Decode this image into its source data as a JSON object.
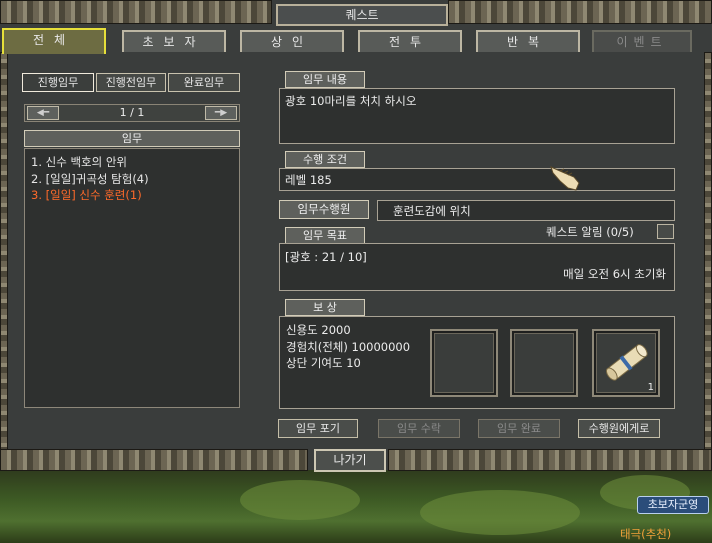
{
  "window": {
    "title": "퀘스트"
  },
  "tabs": [
    {
      "label": "전체",
      "state": "active"
    },
    {
      "label": "초보자",
      "state": "normal"
    },
    {
      "label": "상인",
      "state": "normal"
    },
    {
      "label": "전투",
      "state": "normal"
    },
    {
      "label": "반복",
      "state": "normal"
    },
    {
      "label": "이벤트",
      "state": "disabled"
    }
  ],
  "left": {
    "subtabs": [
      "진행임무",
      "진행전임무",
      "완료임무"
    ],
    "pager": {
      "text": "1 / 1"
    },
    "list_header": "임무",
    "quests": [
      {
        "label": "1. 신수 백호의 안위",
        "selected": false
      },
      {
        "label": "2. [일일]귀곡성 탐험(4)",
        "selected": false
      },
      {
        "label": "3. [일일] 신수 훈련(1)",
        "selected": true
      }
    ]
  },
  "right": {
    "content_label": "임무 내용",
    "content_text": "광호 10마리를 처치 하시오",
    "condition_label": "수행 조건",
    "condition_text": "레벨 185",
    "performer_label": "임무수행원",
    "performer_text": "훈련도감에 위치",
    "alarm_text": "퀘스트 알림 (0/5)",
    "goal_label": "임무 목표",
    "goal_progress": "[광호 : 21 / 10]",
    "goal_reset": "매일 오전 6시 초기화",
    "reward_label": "보 상",
    "rewards": [
      "신용도 2000",
      "경험치(전체) 10000000",
      "상단 기여도 10"
    ],
    "reward_item_count": "1"
  },
  "buttons": [
    {
      "label": "임무 포기",
      "enabled": true
    },
    {
      "label": "임무 수락",
      "enabled": false
    },
    {
      "label": "임무 완료",
      "enabled": false
    },
    {
      "label": "수행원에게로",
      "enabled": true
    }
  ],
  "exit_label": "나가기",
  "overlay": {
    "guild_button": "초보자군영",
    "player_name": "태극(추천)"
  },
  "colors": {
    "selected_quest": "#ff6a2a",
    "active_tab_border": "#e6df3a",
    "player_name": "#f2a23a"
  }
}
